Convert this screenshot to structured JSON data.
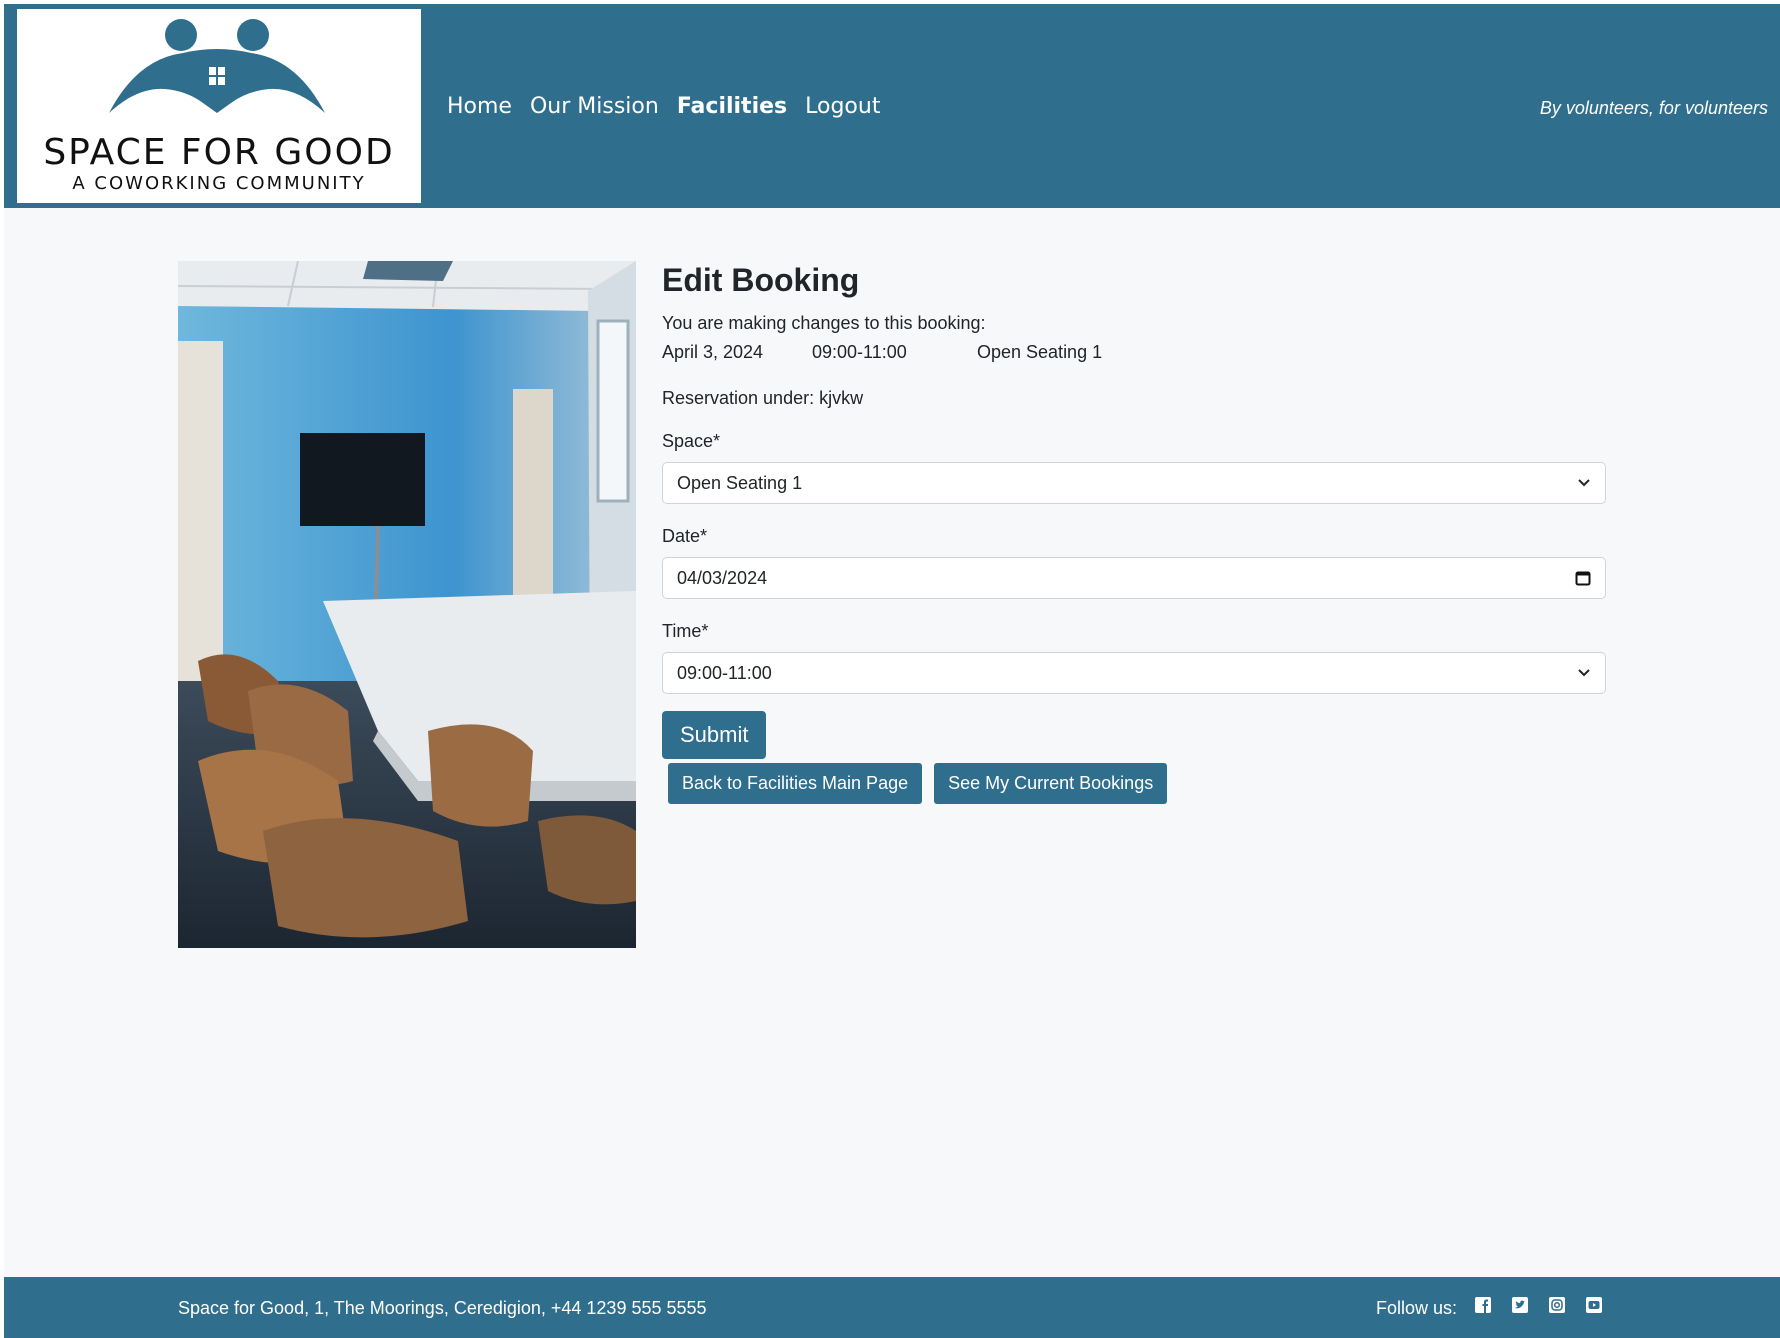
{
  "header": {
    "logo": {
      "title": "SPACE FOR GOOD",
      "subtitle": "A COWORKING COMMUNITY"
    },
    "nav": [
      {
        "label": "Home"
      },
      {
        "label": "Our Mission"
      },
      {
        "label": "Facilities",
        "active": true
      },
      {
        "label": "Logout"
      }
    ],
    "tagline": "By volunteers, for volunteers"
  },
  "main": {
    "photo_icon": "meeting-room-photo",
    "title": "Edit Booking",
    "intro": "You are making changes to this booking:",
    "booking": {
      "date": "April 3, 2024",
      "time": "09:00-11:00",
      "space": "Open Seating 1"
    },
    "reservation": "Reservation under: kjvkw",
    "form": {
      "space_label": "Space*",
      "space_value": "Open Seating 1",
      "date_label": "Date*",
      "date_value": "04/03/2024",
      "time_label": "Time*",
      "time_value": "09:00-11:00",
      "submit_label": "Submit"
    },
    "buttons": {
      "back": "Back to Facilities Main Page",
      "bookings": "See My Current Bookings"
    }
  },
  "footer": {
    "address": "Space for Good, 1, The Moorings, Ceredigion, +44 1239 555 5555",
    "follow": "Follow us:",
    "socials": [
      "facebook-icon",
      "twitter-icon",
      "instagram-icon",
      "youtube-icon"
    ]
  },
  "colors": {
    "brand": "#2f6f8d",
    "background": "#f7f8fa"
  }
}
